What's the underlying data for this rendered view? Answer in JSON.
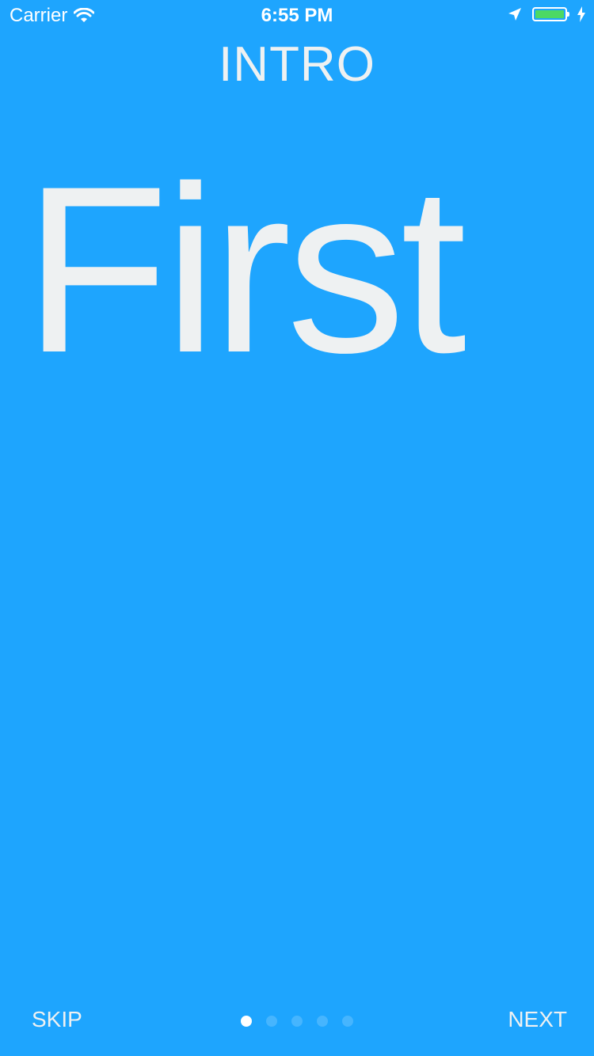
{
  "status_bar": {
    "carrier": "Carrier",
    "time": "6:55 PM",
    "battery_color": "#4cd964"
  },
  "header": {
    "title": "INTRO"
  },
  "page": {
    "hero_text": "First"
  },
  "footer": {
    "skip_label": "SKIP",
    "next_label": "NEXT",
    "page_count": 5,
    "current_page": 1
  },
  "colors": {
    "background": "#1ea5fe",
    "text": "#eef1f2"
  }
}
